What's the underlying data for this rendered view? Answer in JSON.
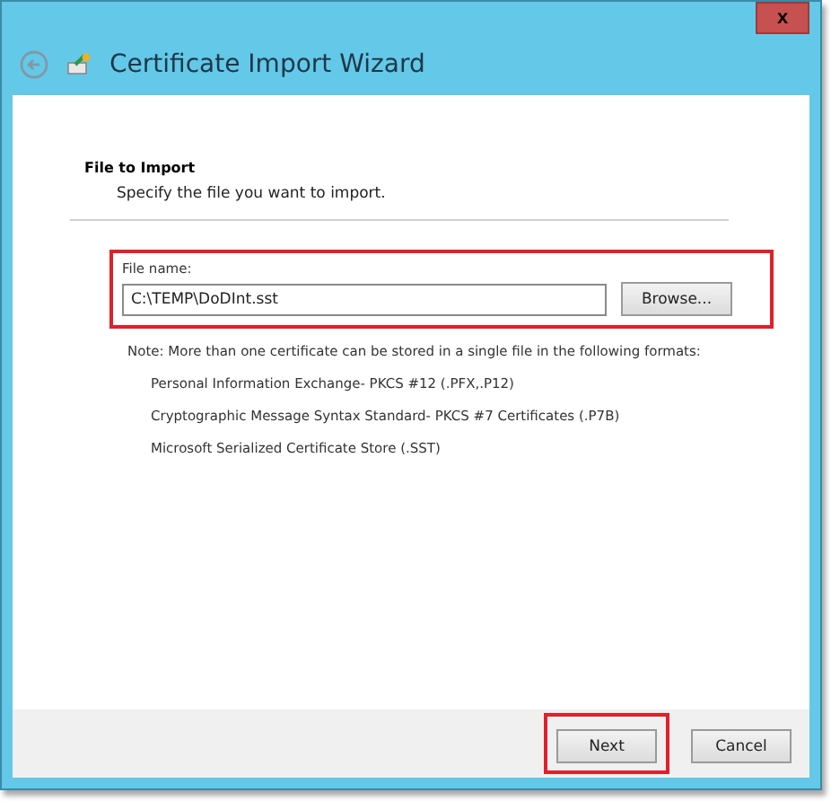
{
  "window": {
    "title": "Certificate Import Wizard",
    "close_label": "x"
  },
  "page": {
    "heading": "File to Import",
    "subheading": "Specify the file you want to import."
  },
  "file_field": {
    "label": "File name:",
    "value": "C:\\TEMP\\DoDInt.sst",
    "highlighted": true
  },
  "browse_button": "Browse...",
  "note": "Note:  More than one certificate can be stored in a single file in the following formats:",
  "formats": [
    "Personal Information Exchange- PKCS #12 (.PFX,.P12)",
    "Cryptographic Message Syntax Standard- PKCS #7 Certificates (.P7B)",
    "Microsoft Serialized Certificate Store (.SST)"
  ],
  "buttons": [
    {
      "label": "Next",
      "highlighted": true
    },
    {
      "label": "Cancel",
      "highlighted": false
    }
  ]
}
